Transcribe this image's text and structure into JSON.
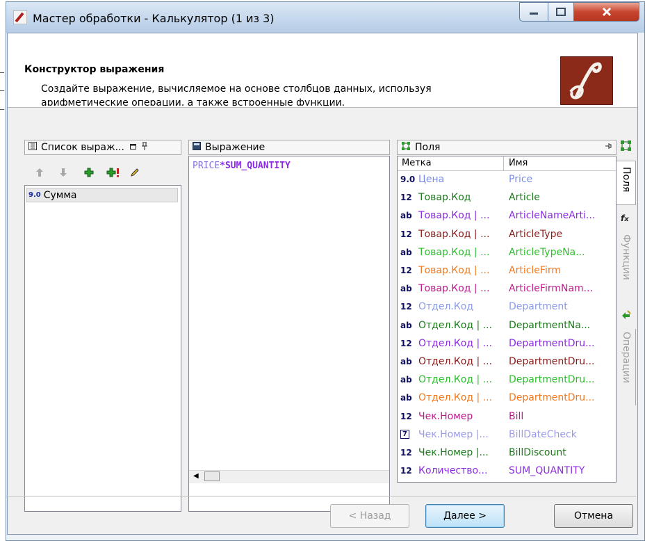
{
  "window": {
    "title": "Мастер обработки - Калькулятор (1 из 3)",
    "controls": {
      "minimize": "—",
      "maximize": "☐",
      "close": "X"
    }
  },
  "header": {
    "title": "Конструктор выражения",
    "description": "Создайте выражение, вычисляемое на основе столбцов данных, используя арифметические операции, а также встроенные функции."
  },
  "list_panel": {
    "title": "Список выраж...",
    "items": [
      {
        "type_tag": "9.0",
        "label": "Сумма"
      }
    ]
  },
  "expression_panel": {
    "title": "Выражение",
    "expression_parts": [
      "PRICE",
      "*",
      "SUM_QUANTITY"
    ]
  },
  "fields_panel": {
    "title": "Поля",
    "columns": {
      "label": "Метка",
      "name": "Имя"
    },
    "rows": [
      {
        "type": "9.0",
        "label": "Цена",
        "name": "Price",
        "color": "#7b8be8"
      },
      {
        "type": "12",
        "label": "Товар.Код",
        "name": "Article",
        "color": "#1a7a1a"
      },
      {
        "type": "ab",
        "label": "Товар.Код | ...",
        "name": "ArticleNameArti...",
        "color": "#8a2be2"
      },
      {
        "type": "12",
        "label": "Товар.Код | ...",
        "name": "ArticleType",
        "color": "#8b1a1a"
      },
      {
        "type": "ab",
        "label": "Товар.Код | ...",
        "name": "ArticleTypeNa...",
        "color": "#2bbf2b"
      },
      {
        "type": "12",
        "label": "Товар.Код | ...",
        "name": "ArticleFirm",
        "color": "#f07820"
      },
      {
        "type": "ab",
        "label": "Товар.Код | ...",
        "name": "ArticleFirmNam...",
        "color": "#c0188c"
      },
      {
        "type": "12",
        "label": "Отдел.Код",
        "name": "Department",
        "color": "#8a9ae8"
      },
      {
        "type": "ab",
        "label": "Отдел.Код | ...",
        "name": "DepartmentNa...",
        "color": "#1a7a1a"
      },
      {
        "type": "12",
        "label": "Отдел.Код | ...",
        "name": "DepartmentDru...",
        "color": "#8a2be2"
      },
      {
        "type": "ab",
        "label": "Отдел.Код | ...",
        "name": "DepartmentDru...",
        "color": "#8b1a1a"
      },
      {
        "type": "ab",
        "label": "Отдел.Код | ...",
        "name": "DepartmentDru...",
        "color": "#2bbf2b"
      },
      {
        "type": "ab",
        "label": "Отдел.Код | ...",
        "name": "DepartmentDru...",
        "color": "#f07820"
      },
      {
        "type": "12",
        "label": "Чек.Номер",
        "name": "Bill",
        "color": "#c0188c"
      },
      {
        "type": "7",
        "label": "Чек.Номер |...",
        "name": "BillDateCheck",
        "color": "#9a9ae8"
      },
      {
        "type": "12",
        "label": "Чек.Номер |...",
        "name": "BillDiscount",
        "color": "#1a7a1a"
      },
      {
        "type": "12",
        "label": "Количество...",
        "name": "SUM_QUANTITY",
        "color": "#8a2be2"
      }
    ]
  },
  "side_tabs": [
    {
      "label": "Поля",
      "active": true
    },
    {
      "label": "Функции",
      "active": false
    },
    {
      "label": "Операции",
      "active": false
    }
  ],
  "footer": {
    "back_label": "< Назад",
    "next_label": "Далее >",
    "cancel_label": "Отмена"
  }
}
